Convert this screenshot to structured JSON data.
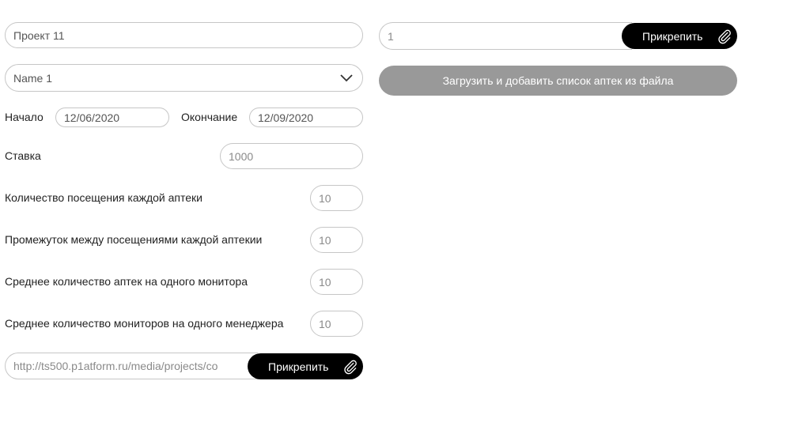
{
  "project": {
    "name_value": "Проект 11",
    "type_select": "Name 1"
  },
  "dates": {
    "start_label": "Начало",
    "start_value": "12/06/2020",
    "end_label": "Окончание",
    "end_value": "12/09/2020"
  },
  "rate": {
    "label": "Ставка",
    "value": "1000"
  },
  "params": [
    {
      "label": "Количество посещения каждой аптеки",
      "value": "10"
    },
    {
      "label": "Промежуток между посещениями каждой аптекии",
      "value": "10"
    },
    {
      "label": "Среднее количество аптек на одного монитора",
      "value": "10"
    },
    {
      "label": "Среднее количество мониторов на одного менеджера",
      "value": "10"
    }
  ],
  "file_attach": {
    "value": "http://ts500.p1atform.ru/media/projects/co",
    "button_label": "Прикрепить"
  },
  "right_attach": {
    "value": "1",
    "button_label": "Прикрепить"
  },
  "upload_button_label": "Загрузить и добавить список аптек из файла",
  "icons": {
    "attach": "paperclip-icon",
    "dropdown": "chevron-down-icon"
  },
  "colors": {
    "primary_button": "#000000",
    "disabled_button": "#999999",
    "border": "#c6c6c6"
  }
}
